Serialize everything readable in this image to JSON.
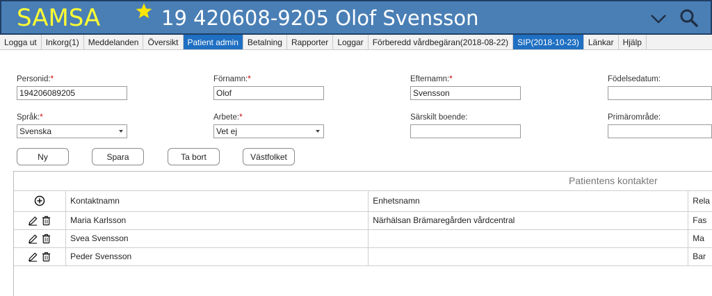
{
  "header": {
    "logo": "SAMSA",
    "patient_title": "19 420608-9205 Olof Svensson"
  },
  "nav": {
    "items": [
      {
        "label": "Logga ut"
      },
      {
        "label": "Inkorg(1)"
      },
      {
        "label": "Meddelanden"
      },
      {
        "label": "Översikt"
      },
      {
        "label": "Patient admin"
      },
      {
        "label": "Betalning"
      },
      {
        "label": "Rapporter"
      },
      {
        "label": "Loggar"
      },
      {
        "label": "Förberedd vårdbegäran(2018-08-22)"
      },
      {
        "label": "SIP(2018-10-23)"
      },
      {
        "label": "Länkar"
      },
      {
        "label": "Hjälp"
      }
    ],
    "active": "Patient admin",
    "active_color": "#1f6fc2"
  },
  "form": {
    "personid": {
      "label": "Personid:",
      "value": "194206089205"
    },
    "fornamn": {
      "label": "Förnamn:",
      "value": "Olof"
    },
    "efternamn": {
      "label": "Efternamn:",
      "value": "Svensson"
    },
    "fodelsedatum": {
      "label": "Födelsedatum:",
      "value": ""
    },
    "sprak": {
      "label": "Språk:",
      "value": "Svenska"
    },
    "arbete": {
      "label": "Arbete:",
      "value": "Vet ej"
    },
    "sarskilt_boende": {
      "label": "Särskilt boende:",
      "value": ""
    },
    "primaromrade": {
      "label": "Primärområde:",
      "value": ""
    },
    "required_mark": "*"
  },
  "buttons": {
    "ny": "Ny",
    "spara": "Spara",
    "ta_bort": "Ta bort",
    "vastfolket": "Västfolket"
  },
  "contacts": {
    "title": "Patientens kontakter",
    "columns": [
      "Kontaktnamn",
      "Enhetsnamn",
      "Rela"
    ],
    "rows": [
      {
        "kontaktnamn": "Maria Karlsson",
        "enhetsnamn": "Närhälsan Brämaregården vårdcentral",
        "relation": "Fas"
      },
      {
        "kontaktnamn": "Svea Svensson",
        "enhetsnamn": "",
        "relation": "Ma"
      },
      {
        "kontaktnamn": "Peder Svensson",
        "enhetsnamn": "",
        "relation": "Bar"
      }
    ]
  },
  "colors": {
    "header_bg": "#4a7fb5",
    "logo": "#ffff33",
    "star": "#ffe600"
  }
}
